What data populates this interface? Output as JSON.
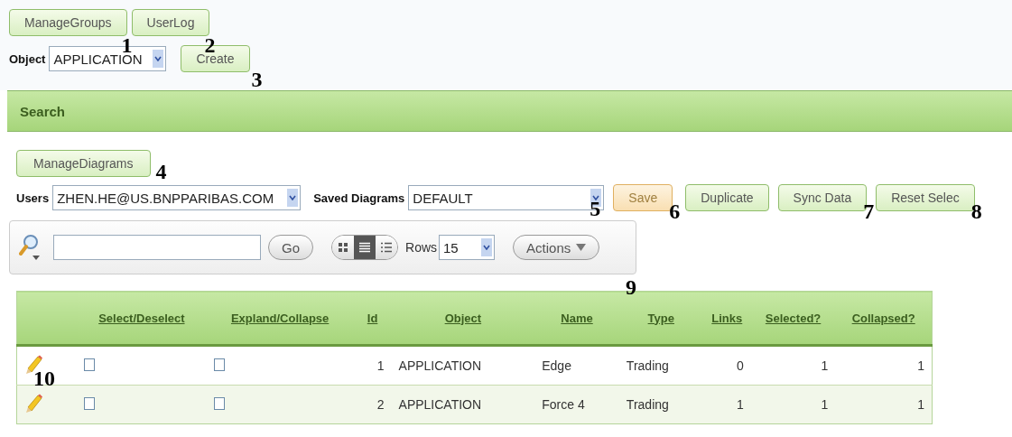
{
  "top_buttons": [
    {
      "label": "ManageGroups",
      "marker": "1"
    },
    {
      "label": "UserLog",
      "marker": "2"
    }
  ],
  "object_select": {
    "label": "Object",
    "value": "APPLICATION"
  },
  "create_button": {
    "label": "Create",
    "marker": "3"
  },
  "search_region": {
    "title": "Search"
  },
  "manage_diagrams_button": {
    "label": "ManageDiagrams",
    "marker": "4"
  },
  "users_select": {
    "label": "Users",
    "value": "ZHEN.HE@US.BNPPARIBAS.COM"
  },
  "saved_diagrams_select": {
    "label": "Saved Diagrams",
    "value": "DEFAULT",
    "marker": "5"
  },
  "action_buttons": [
    {
      "label": "Save",
      "highlighted": true,
      "marker": "6"
    },
    {
      "label": "Duplicate",
      "highlighted": false
    },
    {
      "label": "Sync Data",
      "highlighted": false,
      "marker": "7"
    },
    {
      "label": "Reset Selec",
      "highlighted": false,
      "marker": "8"
    }
  ],
  "toolbar": {
    "go_button": "Go",
    "views": [
      {
        "kind": "icons",
        "selected": false
      },
      {
        "kind": "report",
        "selected": true
      },
      {
        "kind": "details",
        "selected": false
      }
    ],
    "rows_label": "Rows",
    "rows_value": "15",
    "actions_button": "Actions",
    "marker": "9"
  },
  "table": {
    "columns": [
      "Select/Deselect",
      "Expland/Collapse",
      "Id",
      "Object",
      "Name",
      "Type",
      "Links",
      "Selected?",
      "Collapsed?"
    ],
    "rows": [
      {
        "cells": [
          {
            "kind": "checkbox",
            "checked": false
          },
          {
            "kind": "checkbox",
            "checked": false
          },
          {
            "kind": "text",
            "text": "1"
          },
          {
            "kind": "text",
            "text": "APPLICATION"
          },
          {
            "kind": "text",
            "text": "Edge"
          },
          {
            "kind": "text",
            "text": "Trading"
          },
          {
            "kind": "text",
            "text": "0"
          },
          {
            "kind": "text",
            "text": "1"
          },
          {
            "kind": "text",
            "text": "1"
          }
        ],
        "marker": "10"
      },
      {
        "cells": [
          {
            "kind": "checkbox",
            "checked": false
          },
          {
            "kind": "checkbox",
            "checked": false
          },
          {
            "kind": "text",
            "text": "2"
          },
          {
            "kind": "text",
            "text": "APPLICATION"
          },
          {
            "kind": "text",
            "text": "Force 4"
          },
          {
            "kind": "text",
            "text": "Trading"
          },
          {
            "kind": "text",
            "text": "1"
          },
          {
            "kind": "text",
            "text": "1"
          },
          {
            "kind": "text",
            "text": "1"
          }
        ]
      }
    ]
  }
}
